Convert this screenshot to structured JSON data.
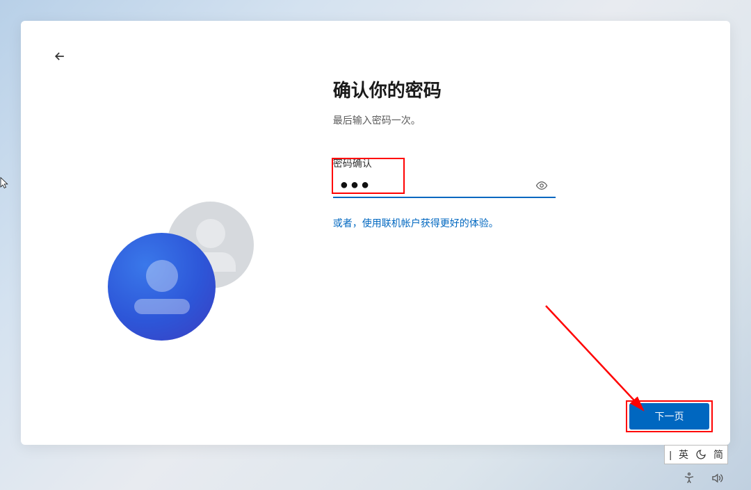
{
  "page": {
    "title": "确认你的密码",
    "subtitle": "最后输入密码一次。"
  },
  "form": {
    "password_label": "密码确认",
    "password_value": "●●●",
    "alt_link": "或者，使用联机帐户获得更好的体验。"
  },
  "nav": {
    "next_label": "下一页"
  },
  "ime": {
    "divider": "|",
    "lang1": "英",
    "lang2": "简"
  }
}
